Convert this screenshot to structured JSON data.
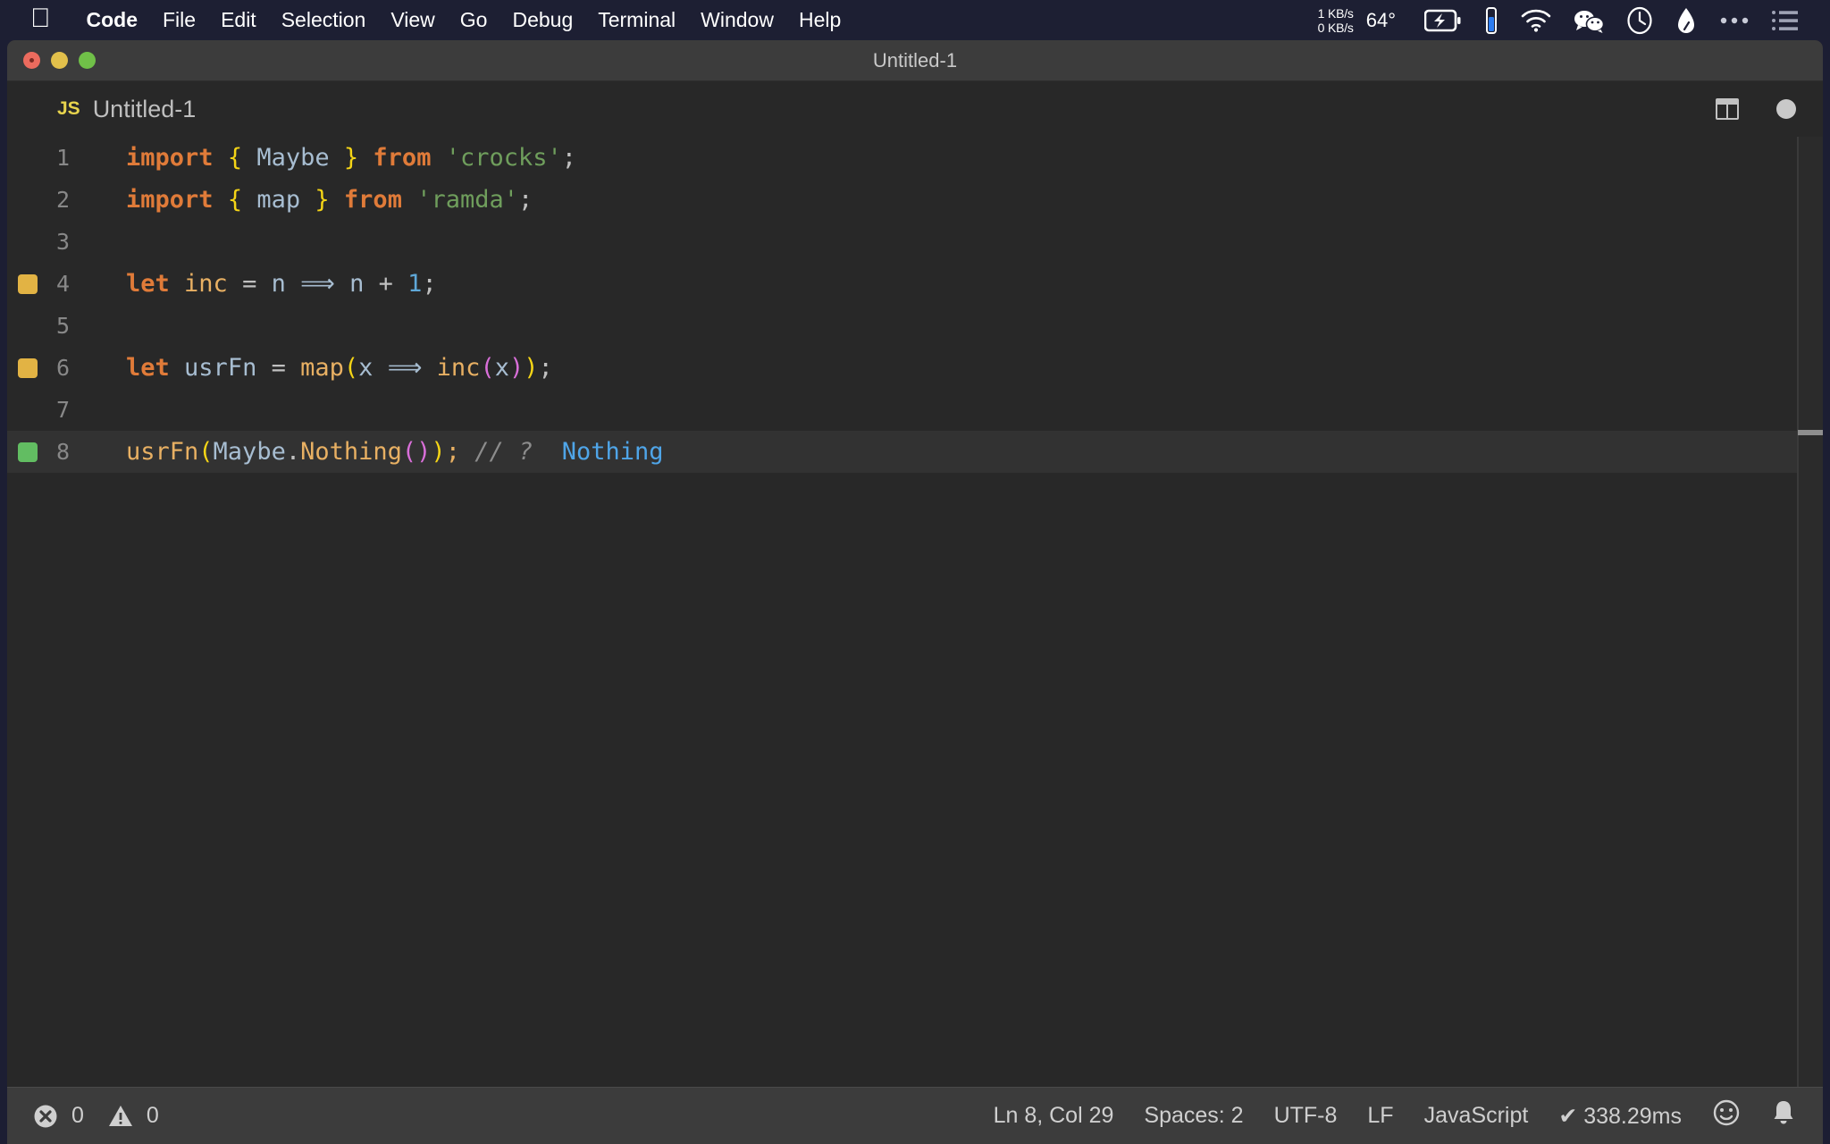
{
  "menubar": {
    "apple_logo": "apple-logo",
    "items": [
      {
        "label": "Code",
        "bold": true
      },
      {
        "label": "File",
        "bold": false
      },
      {
        "label": "Edit",
        "bold": false
      },
      {
        "label": "Selection",
        "bold": false
      },
      {
        "label": "View",
        "bold": false
      },
      {
        "label": "Go",
        "bold": false
      },
      {
        "label": "Debug",
        "bold": false
      },
      {
        "label": "Terminal",
        "bold": false
      },
      {
        "label": "Window",
        "bold": false
      },
      {
        "label": "Help",
        "bold": false
      }
    ],
    "net_up": "1 KB/s",
    "net_down": "0 KB/s",
    "temperature": "64°",
    "tray_icons": [
      "battery-charging-icon",
      "battery-vertical-icon",
      "wifi-icon",
      "wechat-icon",
      "clock-icon",
      "bartender-icon",
      "ellipsis-icon",
      "list-menu-icon"
    ]
  },
  "window": {
    "title": "Untitled-1",
    "traffic_lights": [
      "close-button",
      "minimize-button",
      "maximize-button"
    ]
  },
  "tab": {
    "badge": "JS",
    "label": "Untitled-1",
    "actions": [
      "split-editor-icon",
      "unsaved-dot-icon"
    ]
  },
  "editor": {
    "lines": [
      {
        "number": "1",
        "marker": "",
        "active": false,
        "tokens": [
          {
            "text": "import",
            "cls": "t-kw"
          },
          {
            "text": " ",
            "cls": "t-punct"
          },
          {
            "text": "{",
            "cls": "t-brace-y"
          },
          {
            "text": " ",
            "cls": "t-punct"
          },
          {
            "text": "Maybe",
            "cls": "t-id"
          },
          {
            "text": " ",
            "cls": "t-punct"
          },
          {
            "text": "}",
            "cls": "t-brace-y"
          },
          {
            "text": " ",
            "cls": "t-punct"
          },
          {
            "text": "from",
            "cls": "t-kw"
          },
          {
            "text": " ",
            "cls": "t-punct"
          },
          {
            "text": "'crocks'",
            "cls": "t-str"
          },
          {
            "text": ";",
            "cls": "t-punct"
          }
        ]
      },
      {
        "number": "2",
        "marker": "",
        "active": false,
        "tokens": [
          {
            "text": "import",
            "cls": "t-kw"
          },
          {
            "text": " ",
            "cls": "t-punct"
          },
          {
            "text": "{",
            "cls": "t-brace-y"
          },
          {
            "text": " ",
            "cls": "t-punct"
          },
          {
            "text": "map",
            "cls": "t-id"
          },
          {
            "text": " ",
            "cls": "t-punct"
          },
          {
            "text": "}",
            "cls": "t-brace-y"
          },
          {
            "text": " ",
            "cls": "t-punct"
          },
          {
            "text": "from",
            "cls": "t-kw"
          },
          {
            "text": " ",
            "cls": "t-punct"
          },
          {
            "text": "'ramda'",
            "cls": "t-str"
          },
          {
            "text": ";",
            "cls": "t-punct"
          }
        ]
      },
      {
        "number": "3",
        "marker": "",
        "active": false,
        "tokens": []
      },
      {
        "number": "4",
        "marker": "warn",
        "active": false,
        "tokens": [
          {
            "text": "let",
            "cls": "t-kw"
          },
          {
            "text": " ",
            "cls": "t-punct"
          },
          {
            "text": "inc",
            "cls": "t-fn"
          },
          {
            "text": " = ",
            "cls": "t-punct"
          },
          {
            "text": "n",
            "cls": "t-var"
          },
          {
            "text": " ",
            "cls": "t-punct"
          },
          {
            "text": "⟹",
            "cls": "t-arrow"
          },
          {
            "text": " ",
            "cls": "t-punct"
          },
          {
            "text": "n",
            "cls": "t-var"
          },
          {
            "text": " + ",
            "cls": "t-punct"
          },
          {
            "text": "1",
            "cls": "t-num"
          },
          {
            "text": ";",
            "cls": "t-punct"
          }
        ]
      },
      {
        "number": "5",
        "marker": "",
        "active": false,
        "tokens": []
      },
      {
        "number": "6",
        "marker": "warn",
        "active": false,
        "tokens": [
          {
            "text": "let",
            "cls": "t-kw"
          },
          {
            "text": " ",
            "cls": "t-punct"
          },
          {
            "text": "usrFn",
            "cls": "t-var"
          },
          {
            "text": " = ",
            "cls": "t-punct"
          },
          {
            "text": "map",
            "cls": "t-fn"
          },
          {
            "text": "(",
            "cls": "t-paren1"
          },
          {
            "text": "x",
            "cls": "t-var"
          },
          {
            "text": " ",
            "cls": "t-punct"
          },
          {
            "text": "⟹",
            "cls": "t-arrow"
          },
          {
            "text": " ",
            "cls": "t-punct"
          },
          {
            "text": "inc",
            "cls": "t-fn"
          },
          {
            "text": "(",
            "cls": "t-paren2"
          },
          {
            "text": "x",
            "cls": "t-var"
          },
          {
            "text": ")",
            "cls": "t-paren2"
          },
          {
            "text": ")",
            "cls": "t-paren1"
          },
          {
            "text": ";",
            "cls": "t-punct"
          }
        ]
      },
      {
        "number": "7",
        "marker": "",
        "active": false,
        "tokens": []
      },
      {
        "number": "8",
        "marker": "ok",
        "active": true,
        "tokens": [
          {
            "text": "usrFn",
            "cls": "t-fn"
          },
          {
            "text": "(",
            "cls": "t-paren1"
          },
          {
            "text": "Maybe",
            "cls": "t-id"
          },
          {
            "text": ".",
            "cls": "t-punct"
          },
          {
            "text": "Nothing",
            "cls": "t-fn"
          },
          {
            "text": "(",
            "cls": "t-paren2"
          },
          {
            "text": ")",
            "cls": "t-paren2"
          },
          {
            "text": ")",
            "cls": "t-paren1"
          },
          {
            "text": ";",
            "cls": "t-fn"
          },
          {
            "text": " ",
            "cls": "t-punct"
          },
          {
            "text": "// ?",
            "cls": "t-comment"
          },
          {
            "text": "  ",
            "cls": "t-punct"
          },
          {
            "text": "Nothing",
            "cls": "t-annot"
          }
        ]
      }
    ]
  },
  "statusbar": {
    "errors": "0",
    "warnings": "0",
    "cursor": "Ln 8, Col 29",
    "indentation": "Spaces: 2",
    "encoding": "UTF-8",
    "eol": "LF",
    "language": "JavaScript",
    "timing": "✔ 338.29ms",
    "right_icons": [
      "smiley-feedback-icon",
      "notifications-bell-icon"
    ]
  },
  "colors": {
    "menubar_bg": "#1d1f33",
    "titlebar_bg": "#3c3c3c",
    "editor_bg": "#282828",
    "active_line_bg": "#323232",
    "statusbar_bg": "#3c3c3c",
    "marker_warn": "#e2b344",
    "marker_ok": "#62bd62"
  }
}
